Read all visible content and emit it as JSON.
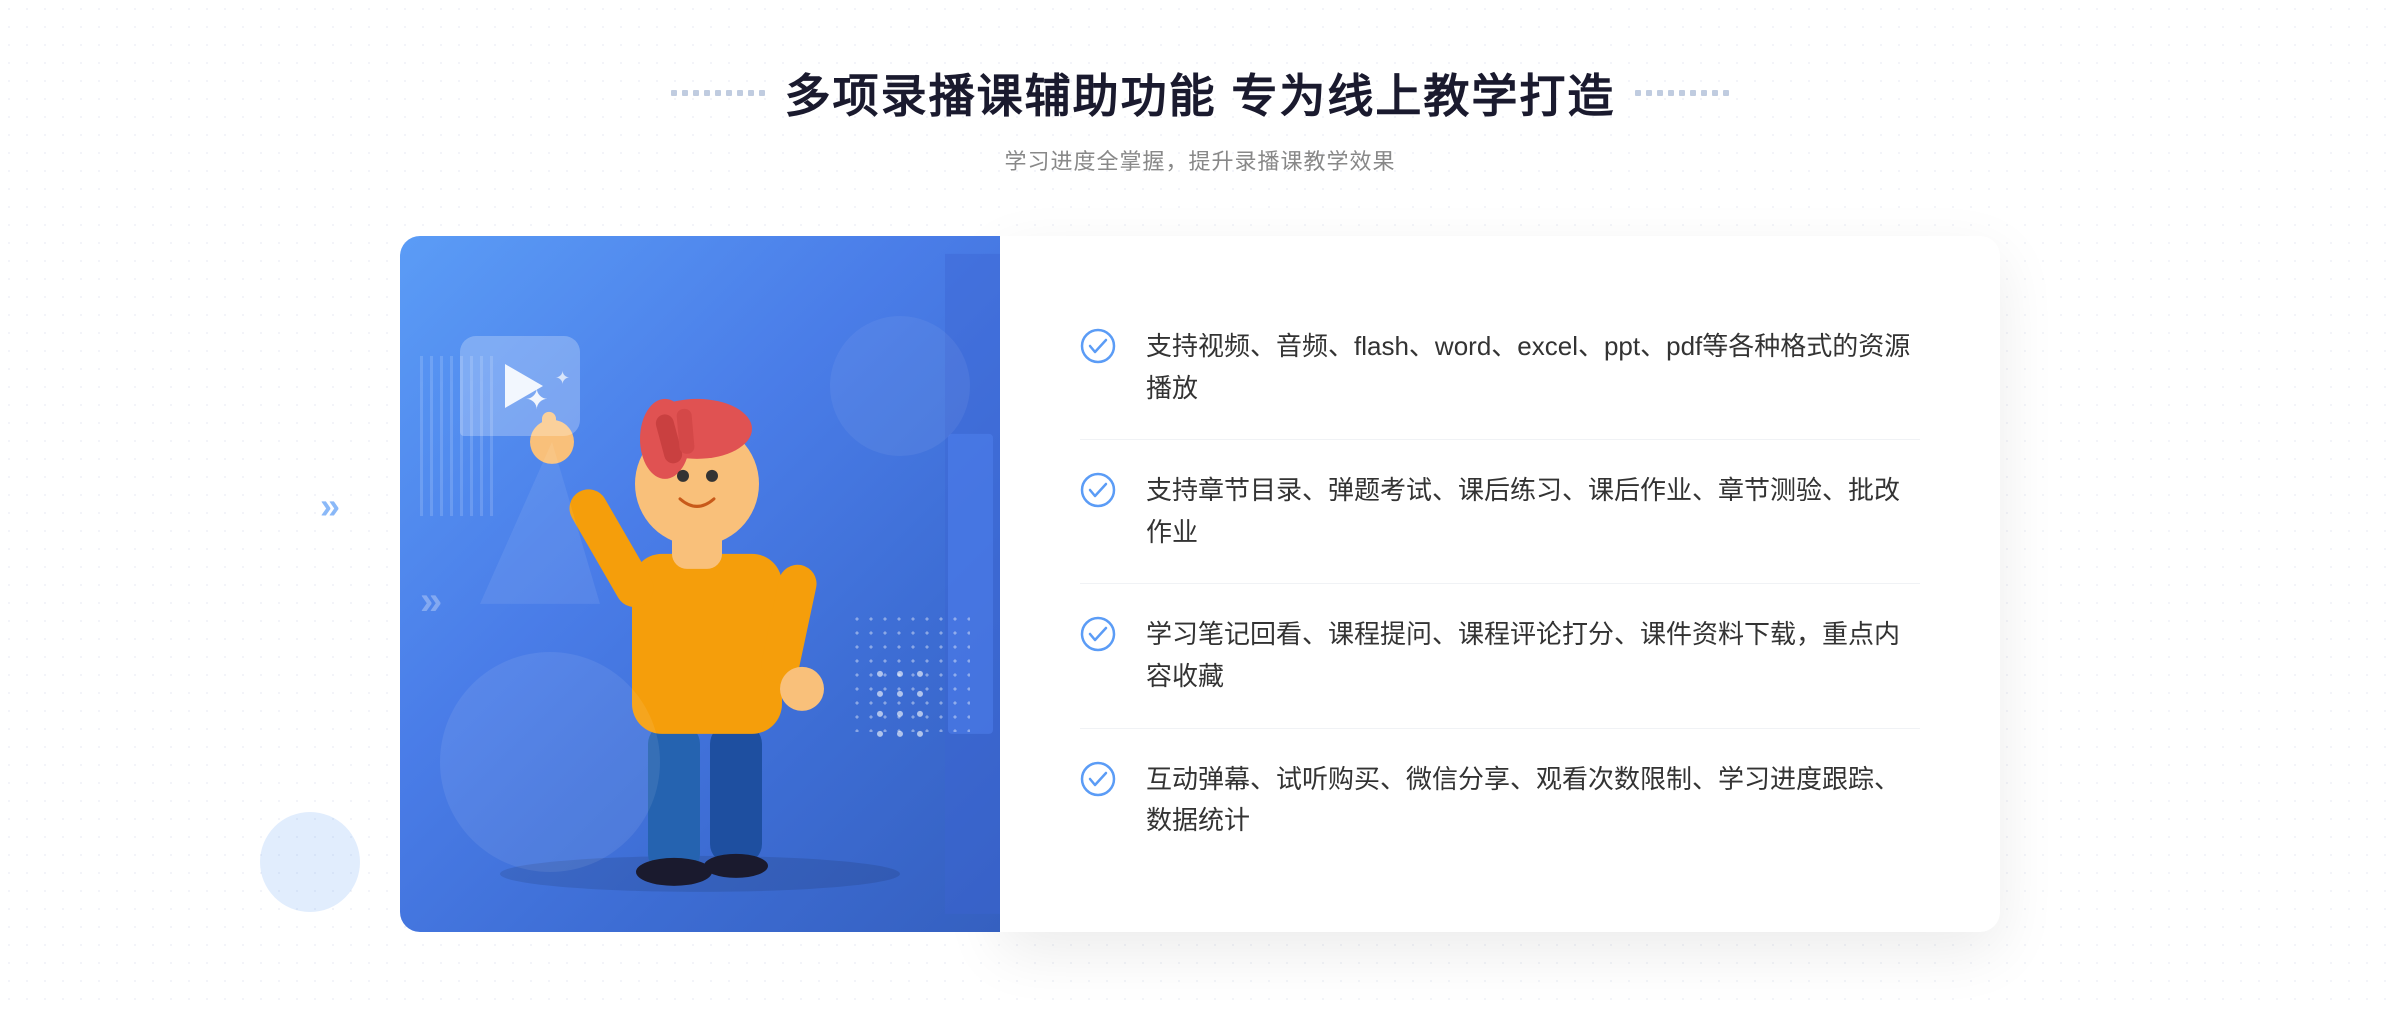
{
  "header": {
    "title": "多项录播课辅助功能 专为线上教学打造",
    "subtitle": "学习进度全掌握，提升录播课教学效果"
  },
  "features": [
    {
      "id": "feature-1",
      "text": "支持视频、音频、flash、word、excel、ppt、pdf等各种格式的资源播放"
    },
    {
      "id": "feature-2",
      "text": "支持章节目录、弹题考试、课后练习、课后作业、章节测验、批改作业"
    },
    {
      "id": "feature-3",
      "text": "学习笔记回看、课程提问、课程评论打分、课件资料下载，重点内容收藏"
    },
    {
      "id": "feature-4",
      "text": "互动弹幕、试听购买、微信分享、观看次数限制、学习进度跟踪、数据统计"
    }
  ],
  "colors": {
    "primary": "#4a7de8",
    "primary_light": "#5b9cf6",
    "text_dark": "#1a1a2e",
    "text_gray": "#888888",
    "text_body": "#333333",
    "check_color": "#5b9cf6"
  },
  "decorative": {
    "left_dots_label": "decorative-dots-left",
    "right_dots_label": "decorative-dots-right",
    "chevron_symbol": "»"
  }
}
